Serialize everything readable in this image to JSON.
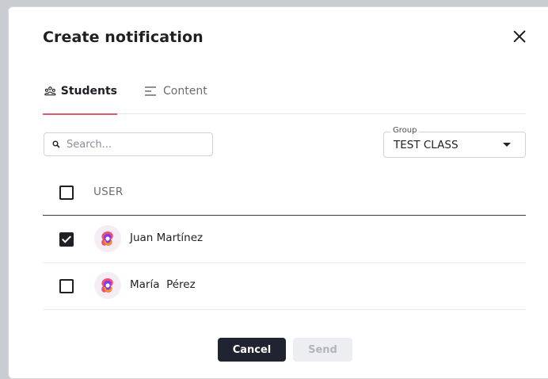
{
  "dialog": {
    "title": "Create notification",
    "close_icon": "close-icon"
  },
  "tabs": [
    {
      "label": "Students",
      "icon": "users-icon",
      "active": true
    },
    {
      "label": "Content",
      "icon": "lines-icon",
      "active": false
    }
  ],
  "search": {
    "placeholder": "Search...",
    "value": "",
    "icon": "search-icon"
  },
  "group": {
    "label": "Group",
    "value": "TEST CLASS"
  },
  "table": {
    "header": {
      "user_label": "USER",
      "select_all_checked": false
    },
    "rows": [
      {
        "name": "Juan Martínez",
        "checked": true
      },
      {
        "name": "María  Pérez",
        "checked": false
      }
    ]
  },
  "actions": {
    "cancel_label": "Cancel",
    "send_label": "Send",
    "send_disabled": true
  },
  "colors": {
    "accent": "#e2576f",
    "primary_button": "#1f2430",
    "disabled_button": "#eceef1"
  }
}
